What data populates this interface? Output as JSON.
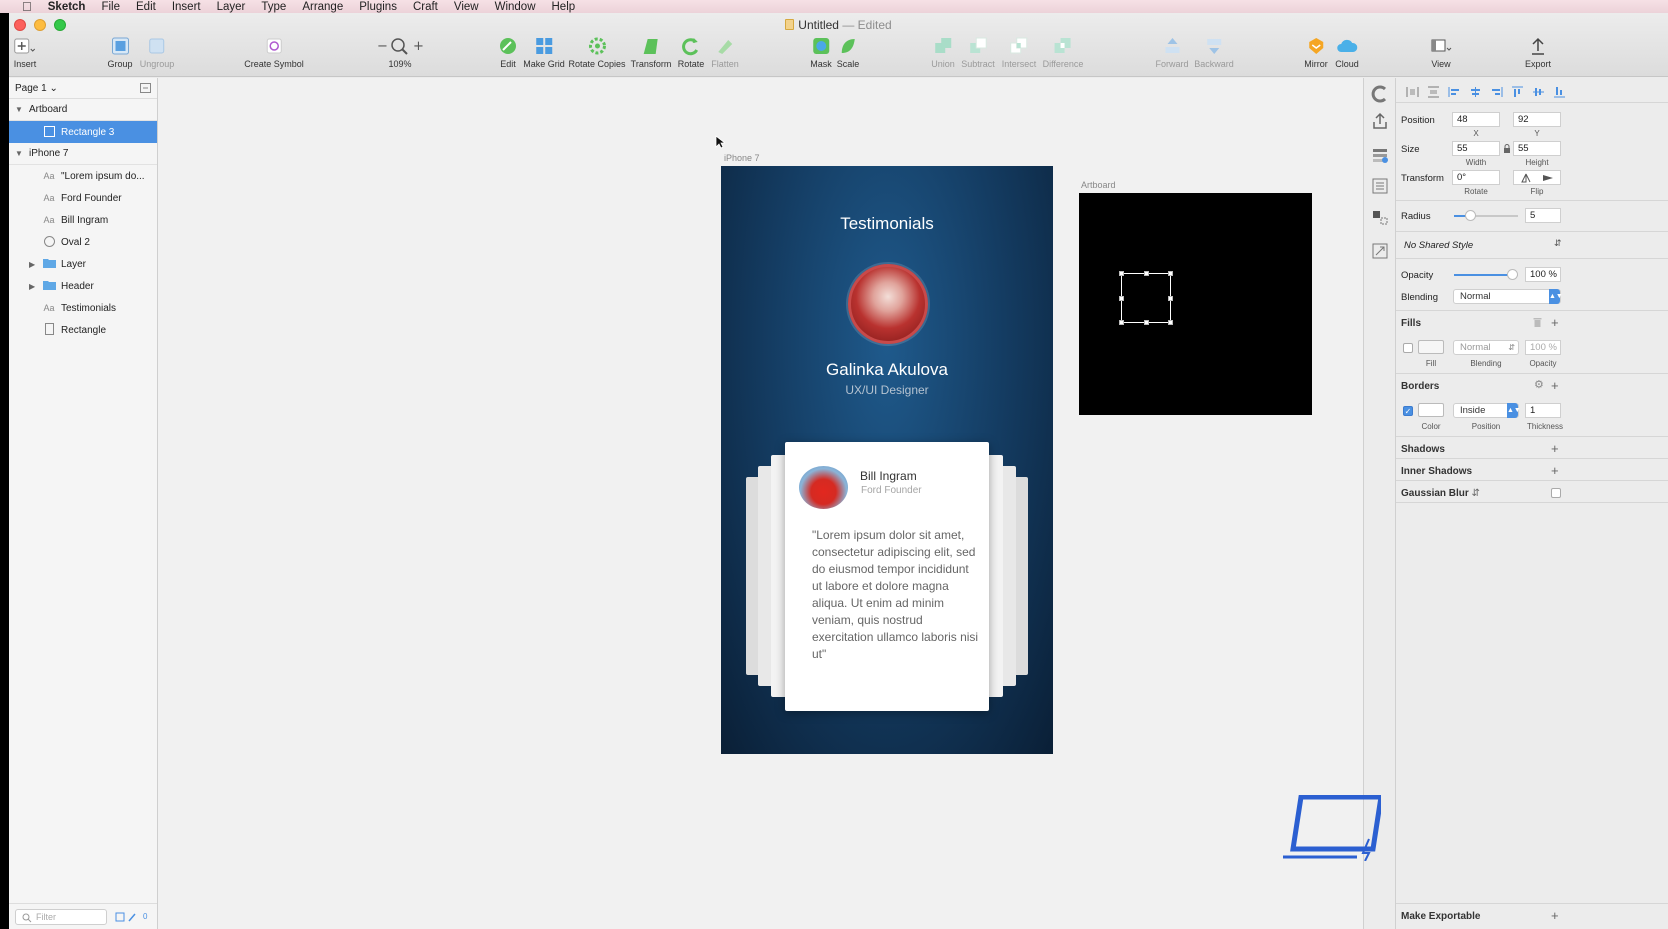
{
  "menubar": {
    "app": "Sketch",
    "items": [
      "File",
      "Edit",
      "Insert",
      "Layer",
      "Type",
      "Arrange",
      "Plugins",
      "Craft",
      "View",
      "Window",
      "Help"
    ]
  },
  "window": {
    "title": "Untitled",
    "status": "— Edited"
  },
  "toolbar": {
    "insert": "Insert",
    "group": "Group",
    "ungroup": "Ungroup",
    "create_symbol": "Create Symbol",
    "zoom": "109%",
    "zoom_minus": "−",
    "zoom_plus": "+",
    "edit": "Edit",
    "make_grid": "Make Grid",
    "rotate_copies": "Rotate Copies",
    "transform": "Transform",
    "rotate": "Rotate",
    "flatten": "Flatten",
    "mask": "Mask",
    "scale": "Scale",
    "union": "Union",
    "subtract": "Subtract",
    "intersect": "Intersect",
    "difference": "Difference",
    "forward": "Forward",
    "backward": "Backward",
    "mirror": "Mirror",
    "cloud": "Cloud",
    "view": "View",
    "export": "Export"
  },
  "layers_panel": {
    "page": "Page 1",
    "groups": [
      {
        "name": "Artboard",
        "children": [
          {
            "name": "Rectangle 3",
            "type": "rect",
            "selected": true
          }
        ]
      },
      {
        "name": "iPhone 7",
        "children": [
          {
            "name": "\"Lorem ipsum do...",
            "type": "text"
          },
          {
            "name": "Ford Founder",
            "type": "text"
          },
          {
            "name": "Bill Ingram",
            "type": "text"
          },
          {
            "name": "Oval 2",
            "type": "oval"
          },
          {
            "name": "Layer",
            "type": "folder"
          },
          {
            "name": "Header",
            "type": "folder"
          },
          {
            "name": "Testimonials",
            "type": "text"
          },
          {
            "name": "Rectangle",
            "type": "rect"
          }
        ]
      }
    ],
    "filter_placeholder": "Filter",
    "count": "0"
  },
  "canvas": {
    "iphone_label": "iPhone 7",
    "artboard_label": "Artboard",
    "testimonials": {
      "heading": "Testimonials",
      "person_name": "Galinka Akulova",
      "person_role": "UX/UI Designer",
      "card_name": "Bill Ingram",
      "card_role": "Ford Founder",
      "quote": "\"Lorem ipsum dolor sit amet, consectetur adipiscing elit, sed do eiusmod tempor incididunt ut labore et dolore magna aliqua. Ut enim ad minim veniam, quis nostrud exercitation ullamco laboris nisi ut\""
    }
  },
  "inspector": {
    "position_label": "Position",
    "x": "48",
    "x_label": "X",
    "y": "92",
    "y_label": "Y",
    "size_label": "Size",
    "width": "55",
    "width_label": "Width",
    "height": "55",
    "height_label": "Height",
    "transform_label": "Transform",
    "rotate": "0°",
    "rotate_label": "Rotate",
    "flip_label": "Flip",
    "radius_label": "Radius",
    "radius": "5",
    "shared_style": "No Shared Style",
    "opacity_label": "Opacity",
    "opacity": "100 %",
    "blending_label": "Blending",
    "blending": "Normal",
    "fills_title": "Fills",
    "fill_label": "Fill",
    "fill_blending": "Normal",
    "fill_blending_label": "Blending",
    "fill_opacity": "100 %",
    "fill_opacity_label": "Opacity",
    "borders_title": "Borders",
    "border_color_label": "Color",
    "border_position": "Inside",
    "border_position_label": "Position",
    "border_thickness": "1",
    "border_thickness_label": "Thickness",
    "shadows_title": "Shadows",
    "inner_shadows_title": "Inner Shadows",
    "gaussian_blur_title": "Gaussian Blur",
    "make_exportable": "Make Exportable"
  },
  "colors": {
    "accent": "#4a90e2",
    "card_bg_top": "#1f5a8c",
    "card_bg_bottom": "#0a1f36"
  }
}
